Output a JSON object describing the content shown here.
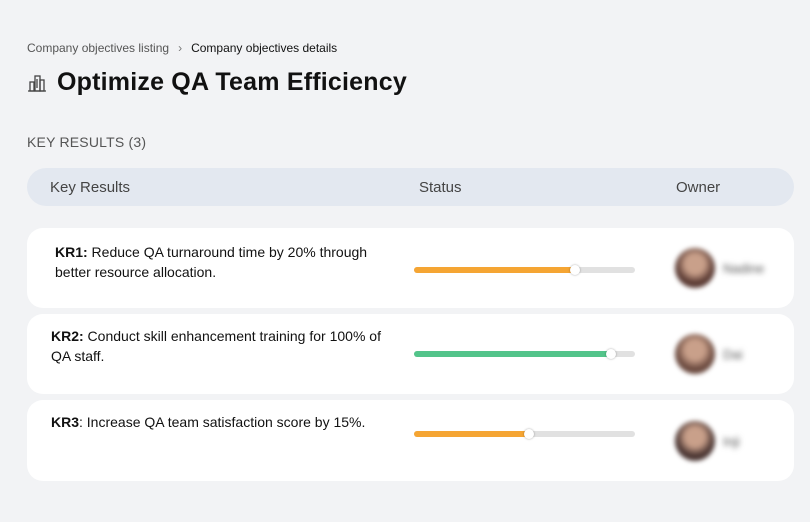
{
  "breadcrumb": {
    "items": [
      "Company objectives listing",
      "Company objectives details"
    ],
    "separator": "›"
  },
  "page": {
    "title": "Optimize QA Team Efficiency",
    "icon": "building-icon"
  },
  "section": {
    "label": "KEY RESULTS (3)"
  },
  "table": {
    "columns": [
      "Key Results",
      "Status",
      "Owner"
    ],
    "rows": [
      {
        "kr_label": "KR1:",
        "kr_text": " Reduce QA turnaround time by 20% through better resource allocation.",
        "progress": 0.73,
        "progress_color": "#f5a533",
        "owner": "Nadine",
        "avatar_color": "#5a3a33"
      },
      {
        "kr_label": "KR2:",
        "kr_text": " Conduct skill enhancement training for 100% of QA staff.",
        "progress": 0.89,
        "progress_color": "#53c48a",
        "owner": "Dai",
        "avatar_color": "#6b4a3f"
      },
      {
        "kr_label": "KR3",
        "kr_text": ": Increase QA team satisfaction score by 15%.",
        "progress": 0.52,
        "progress_color": "#f5a533",
        "owner": "Inji",
        "avatar_color": "#4a3532"
      }
    ]
  }
}
